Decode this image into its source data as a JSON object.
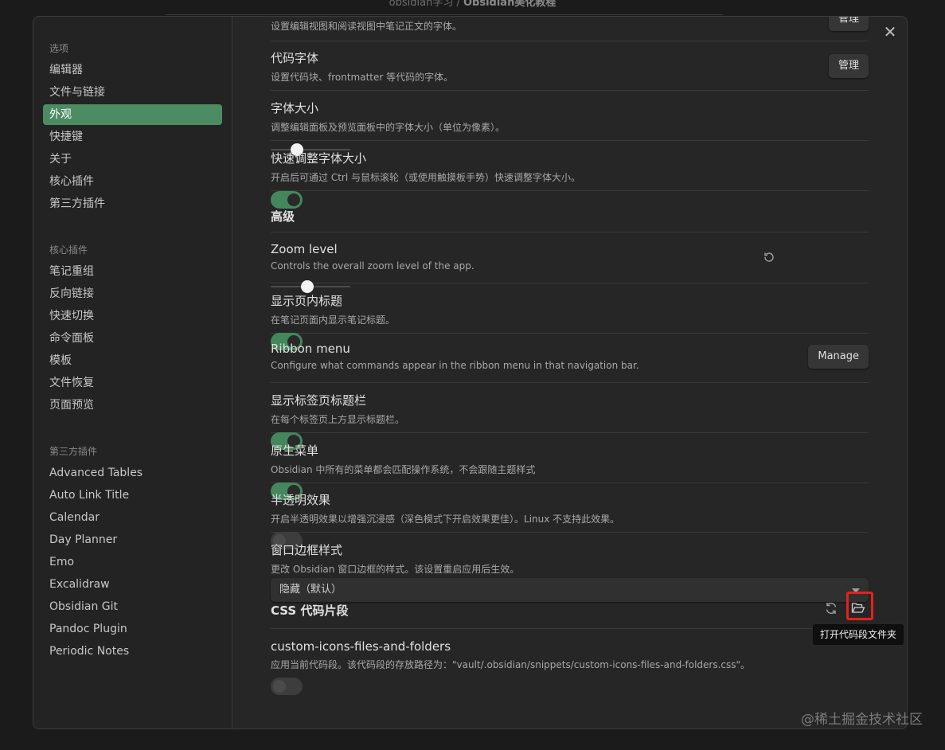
{
  "window": {
    "title_prefix": "obsidian学习 / ",
    "title_bold": "Obsidian美化教程"
  },
  "sidebar": {
    "groups": [
      {
        "heading": "选项",
        "items": [
          "编辑器",
          "文件与链接",
          "外观",
          "快捷键",
          "关于",
          "核心插件",
          "第三方插件"
        ],
        "active": "外观"
      },
      {
        "heading": "核心插件",
        "items": [
          "笔记重组",
          "反向链接",
          "快速切换",
          "命令面板",
          "模板",
          "文件恢复",
          "页面预览"
        ]
      },
      {
        "heading": "第三方插件",
        "items": [
          "Advanced Tables",
          "Auto Link Title",
          "Calendar",
          "Day Planner",
          "Emo",
          "Excalidraw",
          "Obsidian Git",
          "Pandoc Plugin",
          "Periodic Notes"
        ]
      }
    ]
  },
  "settings": {
    "top_partial": {
      "desc": "设置编辑视图和阅读视图中笔记正文的字体。",
      "button": "管理"
    },
    "code_font": {
      "name": "代码字体",
      "desc": "设置代码块、frontmatter 等代码的字体。",
      "button": "管理"
    },
    "font_size": {
      "name": "字体大小",
      "desc": "调整编辑面板及预览面板中的字体大小（单位为像素）。",
      "value_fraction": 0.33
    },
    "quick_font": {
      "name": "快速调整字体大小",
      "desc": "开启后可通过 Ctrl 与鼠标滚轮（或使用触摸板手势）快速调整字体大小。",
      "enabled": true
    },
    "advanced_heading": "高级",
    "zoom": {
      "name": "Zoom level",
      "desc": "Controls the overall zoom level of the app.",
      "value_fraction": 0.46
    },
    "inline_title": {
      "name": "显示页内标题",
      "desc": "在笔记页面内显示笔记标题。",
      "enabled": true
    },
    "ribbon": {
      "name": "Ribbon menu",
      "desc": "Configure what commands appear in the ribbon menu in that navigation bar.",
      "button": "Manage"
    },
    "tab_title": {
      "name": "显示标签页标题栏",
      "desc": "在每个标签页上方显示标题栏。",
      "enabled": true
    },
    "native_menu": {
      "name": "原生菜单",
      "desc": "Obsidian 中所有的菜单都会匹配操作系统，不会跟随主题样式",
      "enabled": true
    },
    "translucent": {
      "name": "半透明效果",
      "desc": "开启半透明效果以增强沉浸感（深色模式下开启效果更佳）。Linux 不支持此效果。",
      "enabled": false
    },
    "frame_style": {
      "name": "窗口边框样式",
      "desc": "更改 Obsidian 窗口边框的样式。该设置重启应用后生效。",
      "selected": "隐藏（默认）"
    },
    "css_heading": "CSS 代码片段",
    "snippet": {
      "name": "custom-icons-files-and-folders",
      "desc": "应用当前代码段。该代码段的存放路径为：\"vault/.obsidian/snippets/custom-icons-files-and-folders.css\"。",
      "enabled": false
    }
  },
  "tooltip": "打开代码段文件夹",
  "watermark": "@稀土掘金技术社区",
  "colors": {
    "accent": "#4c8c63",
    "highlight": "#e8201c"
  }
}
